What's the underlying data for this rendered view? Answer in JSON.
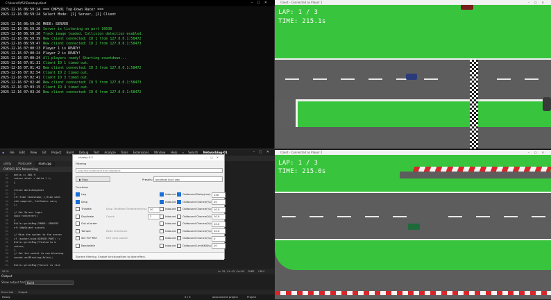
{
  "console": {
    "title": "C:\\Users\\9\\f52\\Desktop\\client",
    "lines": [
      {
        "ts": "2025-12-16 06:59:24",
        "text": "=== CMP501 Top-Down Racer ===",
        "color": "w"
      },
      {
        "ts": "2025-12-16 06:59:24",
        "text": "Select Mode: [1] Server, [2] Client",
        "color": "w"
      },
      {
        "ts": "",
        "text": "",
        "color": "w"
      },
      {
        "ts": "2025-12-16 06:59:26",
        "text": "MODE: SERVER",
        "color": "w"
      },
      {
        "ts": "2025-12-16 06:59:26",
        "text": "Server is listening on port 10030",
        "color": "g"
      },
      {
        "ts": "2025-12-16 06:59:26",
        "text": "Track image loaded. Collision detection enabled.",
        "color": "g"
      },
      {
        "ts": "2025-12-16 06:59:39",
        "text": "New client connected: ID 1 from 127.0.0.1:58472",
        "color": "g"
      },
      {
        "ts": "2025-12-16 06:59:47",
        "text": "New client connected: ID 2 from 127.0.0.1:58473",
        "color": "g"
      },
      {
        "ts": "2025-12-16 07:00:23",
        "text": "Player 1 is READY!",
        "color": "w"
      },
      {
        "ts": "2025-12-16 07:00:24",
        "text": "Player 2 is READY!",
        "color": "w"
      },
      {
        "ts": "2025-12-16 07:00:24",
        "text": "All players ready! Starting countdown...",
        "color": "g"
      },
      {
        "ts": "2025-12-16 07:01:31",
        "text": "Client ID 1 timed out.",
        "color": "g"
      },
      {
        "ts": "2025-12-16 07:01:42",
        "text": "New client connected: ID 3 from 127.0.0.1:58472",
        "color": "g"
      },
      {
        "ts": "2025-12-16 07:02:54",
        "text": "Client ID 2 timed out.",
        "color": "g"
      },
      {
        "ts": "2025-12-16 07:02:41",
        "text": "Client ID 3 timed out.",
        "color": "g"
      },
      {
        "ts": "2025-12-16 07:02:46",
        "text": "New client connected: ID 5 from 127.0.0.1:58473",
        "color": "g"
      },
      {
        "ts": "2025-12-16 07:03:15",
        "text": "Client ID 4 timed out.",
        "color": "g"
      },
      {
        "ts": "2025-12-16 07:03:26",
        "text": "New client connected: ID 6 from 127.0.0.1:58472",
        "color": "g"
      }
    ]
  },
  "game_top": {
    "title": "Client - Connected as Player 1",
    "lap": "LAP: 1 / 3",
    "time": "TIME: 215.1s"
  },
  "game_bottom": {
    "title": "Client - Connected as Player 2",
    "lap": "LAP: 1 / 3",
    "time": "TIME: 215.0s"
  },
  "ide": {
    "menu": [
      "File",
      "Edit",
      "View",
      "Git",
      "Project",
      "Build",
      "Debug",
      "Test",
      "Analyze",
      "Tools",
      "Extensions",
      "Window",
      "Help"
    ],
    "search": "Search",
    "solution": "Networking-01",
    "tabs": [
      "utility",
      "ProtocolH",
      "main.cpp"
    ],
    "nav": "CMP501 ECS Networking",
    "code": [
      {
        "n": "37",
        "t": "        delta == 360.f;"
      },
      {
        "n": "38",
        "t": "        return start + delta * t;"
      },
      {
        "n": "39",
        "t": "    }"
      },
      {
        "n": "40",
        "t": ""
      },
      {
        "n": "41",
        "t": "struct AmrisSnapshot"
      },
      {
        "n": "42",
        "t": "{"
      },
      {
        "n": "43",
        "t": "    sf::Time timestamp; //time when"
      },
      {
        "n": "44",
        "t": "    std::map<int, CarState> cars;"
      },
      {
        "n": "45",
        "t": "};"
      },
      {
        "n": "46",
        "t": ""
      },
      {
        "n": "47",
        "t": "// Set Server logic"
      },
      {
        "n": "48",
        "t": "void runServer()"
      },
      {
        "n": "49",
        "t": "{"
      },
      {
        "n": "50",
        "t": "    Utils::printMsg(\"MODE: SERVER\""
      },
      {
        "n": "51",
        "t": "    sf::UdpSocket socket;"
      },
      {
        "n": "52",
        "t": ""
      },
      {
        "n": "53",
        "t": "    // Bind the socket to the server"
      },
      {
        "n": "54",
        "t": "    if (socket.bind(SERVER_PORT) !="
      },
      {
        "n": "55",
        "t": "        Utils::printMsg(\"Failed to b"
      },
      {
        "n": "56",
        "t": "        return;"
      },
      {
        "n": "57",
        "t": "    }"
      },
      {
        "n": "58",
        "t": "    // Set the socket to non-blocking"
      },
      {
        "n": "59",
        "t": "    socket.setBlocking(false);"
      },
      {
        "n": "60",
        "t": ""
      },
      {
        "n": "61",
        "t": "    Utils::printMsg(\"Server is list"
      }
    ],
    "zoom": "95 %",
    "status_pos": "Ln 35, Ch 43, Col 64",
    "status_tabs": "TABS",
    "status_crlf": "CRLF",
    "output_title": "Output",
    "output_from_label": "Show output from:",
    "output_from_value": "Build",
    "bottom_tabs": [
      "Error List",
      "Output"
    ],
    "ready": "Ready",
    "git_counts": "0 / 0",
    "branch": "assessment project",
    "project": "Project"
  },
  "clumsy": {
    "title": "clumsy 0.3",
    "filtering_label": "Filtering",
    "filter_text": "udp and outbound and loopback",
    "stop_label": "Stop",
    "presets_label": "Presets:",
    "presets_value": "localhost ipv4 udp",
    "functions_label": "Functions",
    "functions": [
      {
        "name": "Lag",
        "on": true,
        "inbound": true,
        "outbound": true,
        "param_label": "Delay(ms):",
        "param_value": "150",
        "extra": ""
      },
      {
        "name": "Drop",
        "on": true,
        "inbound": true,
        "outbound": true,
        "param_label": "Chance(%):",
        "param_value": "20",
        "extra": ""
      },
      {
        "name": "Throttle",
        "on": false,
        "inbound": true,
        "outbound": true,
        "param_label": "Chance(%):",
        "param_value": "10.0",
        "extra": "Drop Throttled   Timeframe(ms):",
        "extra_value": "30"
      },
      {
        "name": "Duplicate",
        "on": false,
        "inbound": true,
        "outbound": true,
        "param_label": "Chance(%):",
        "param_value": "10.0",
        "extra": "Count:",
        "extra_value": "2"
      },
      {
        "name": "Out of order",
        "on": false,
        "inbound": true,
        "outbound": true,
        "param_label": "Chance(%):",
        "param_value": "10.0",
        "extra": ""
      },
      {
        "name": "Tamper",
        "on": false,
        "inbound": true,
        "outbound": true,
        "param_label": "Chance(%):",
        "param_value": "10.0",
        "extra": "Redo Checksum"
      },
      {
        "name": "Set TCP RST",
        "on": false,
        "inbound": true,
        "outbound": true,
        "param_label": "Chance(%):",
        "param_value": "0",
        "extra": "RST next packet"
      },
      {
        "name": "Bandwidth",
        "on": false,
        "inbound": true,
        "outbound": true,
        "param_label": "Limit(KB/s):",
        "param_value": "10",
        "extra": ""
      }
    ],
    "inbound_label": "Inbound",
    "outbound_label": "Outbound",
    "status": "Started filtering. Enable functionalities to take effect."
  }
}
